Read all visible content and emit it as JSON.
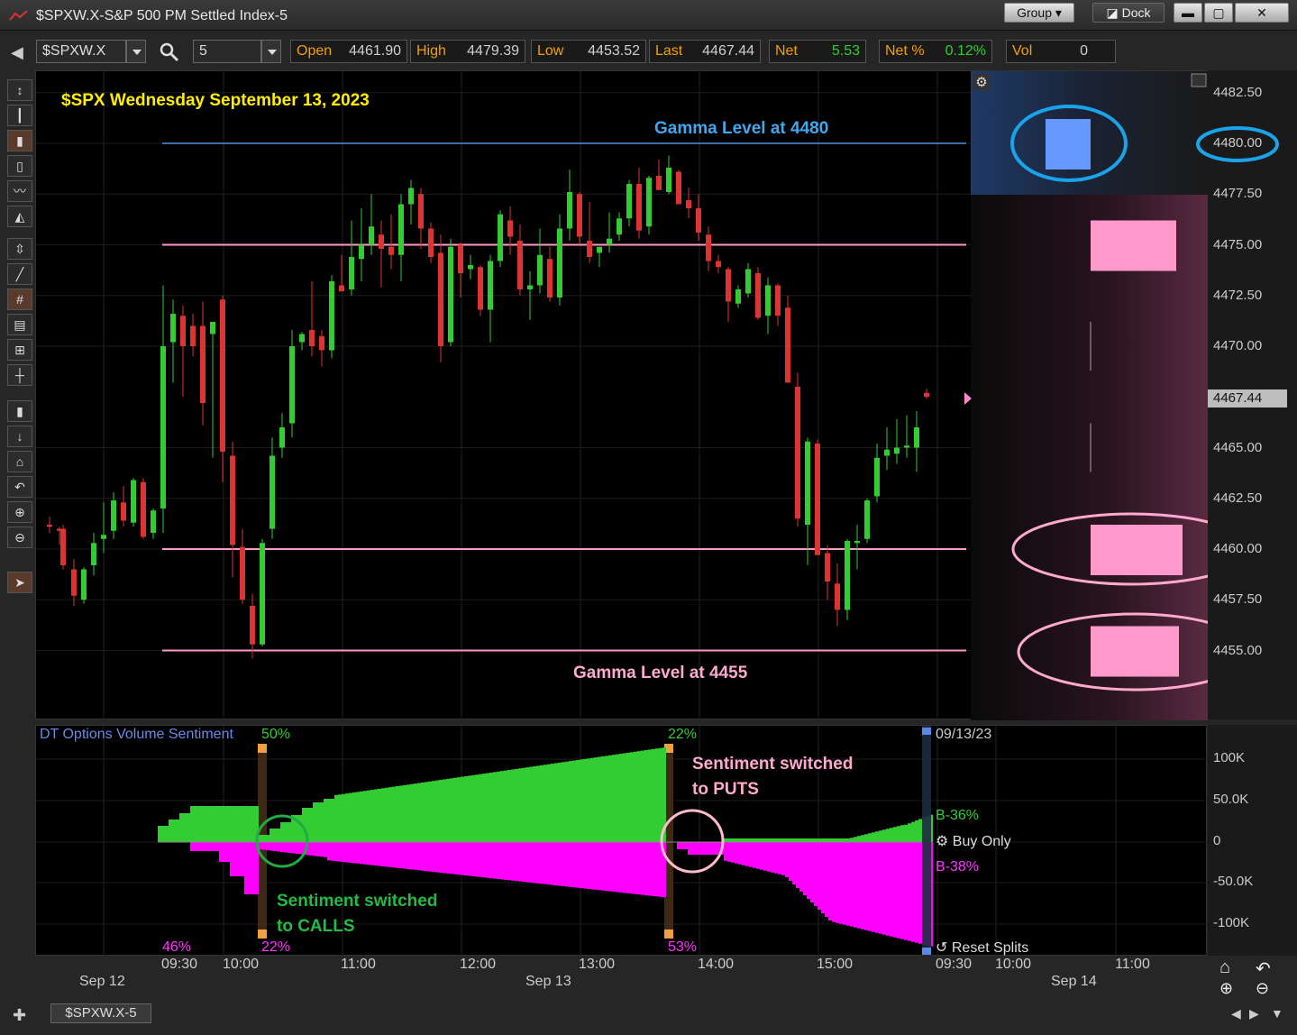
{
  "window": {
    "title": "$SPXW.X-S&P 500 PM Settled Index-5",
    "group_label": "Group",
    "dock_label": "Dock"
  },
  "toolbar": {
    "symbol": "$SPXW.X",
    "interval": "5",
    "quote": {
      "open_label": "Open",
      "open": "4461.90",
      "high_label": "High",
      "high": "4479.39",
      "low_label": "Low",
      "low": "4453.52",
      "last_label": "Last",
      "last": "4467.44",
      "net_label": "Net",
      "net": "5.53",
      "netpct_label": "Net %",
      "netpct": "0.12%",
      "vol_label": "Vol",
      "vol": "0"
    }
  },
  "annotations": {
    "header": "$SPX Wednesday September 13, 2023",
    "gamma_4480": "Gamma Level at 4480",
    "gamma_4455": "Gamma Level at 4455",
    "switch_puts_1": "Sentiment switched",
    "switch_puts_2": "to PUTS",
    "switch_calls_1": "Sentiment switched",
    "switch_calls_2": "to CALLS"
  },
  "price_axis": {
    "ticks": [
      "4482.50",
      "4480.00",
      "4477.50",
      "4475.00",
      "4472.50",
      "4470.00",
      "4465.00",
      "4462.50",
      "4460.00",
      "4457.50",
      "4455.00"
    ],
    "last_marker": "4467.44"
  },
  "sentiment": {
    "title": "DT Options Volume Sentiment",
    "pct_50": "50%",
    "pct_22a": "22%",
    "pct_46": "46%",
    "pct_22b": "22%",
    "pct_53": "53%",
    "date": "09/13/23",
    "b_pos": "B-36%",
    "b_neg": "B-38%",
    "buy_only": "Buy Only",
    "reset_splits": "Reset Splits",
    "axis": [
      "100K",
      "50.0K",
      "0",
      "-50.0K",
      "-100K"
    ]
  },
  "time_axis": {
    "labels": [
      "09:30",
      "10:00",
      "11:00",
      "12:00",
      "13:00",
      "14:00",
      "15:00",
      "09:30",
      "10:00",
      "11:00"
    ],
    "dates": [
      "Sep 12",
      "Sep 13",
      "Sep 14"
    ]
  },
  "bottom_tab": "$SPXW.X-5",
  "colors": {
    "up": "#33cc33",
    "down": "#dd3333",
    "gamma_blue": "#4a90e2",
    "gamma_pink": "#ff99cc",
    "header_yellow": "#ffee00",
    "sent_green": "#33cc33",
    "sent_magenta": "#ff00ff"
  }
}
